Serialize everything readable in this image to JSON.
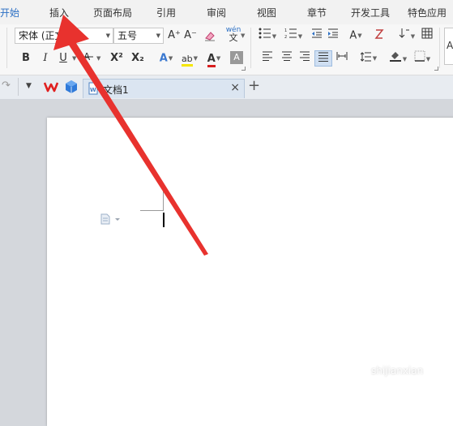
{
  "menu": {
    "items": [
      {
        "label": "开始",
        "active": true
      },
      {
        "label": "插入"
      },
      {
        "label": "页面布局"
      },
      {
        "label": "引用"
      },
      {
        "label": "审阅"
      },
      {
        "label": "视图"
      },
      {
        "label": "章节"
      },
      {
        "label": "开发工具"
      },
      {
        "label": "特色应用"
      }
    ]
  },
  "ribbon": {
    "font_name": "宋体 (正文)",
    "font_size": "五号",
    "grow_font": "A⁺",
    "shrink_font": "A⁻",
    "phonetic_top": "wén",
    "phonetic_bottom": "文",
    "bold": "B",
    "italic": "I",
    "underline": "U",
    "superscript": "X²",
    "subscript": "X₂",
    "text_effect": "A",
    "highlight": "ab",
    "font_color": "A",
    "char_shading": "A",
    "char_case": "A",
    "style_preview": "A"
  },
  "tabs": {
    "document_title": "文档1",
    "new_tab": "+",
    "close": "×"
  },
  "watermark": "shijianxian",
  "colors": {
    "accent": "#2b6fc4",
    "arrow": "#e8322e",
    "highlight": "#f5e600",
    "font_color": "#d81e1e"
  }
}
